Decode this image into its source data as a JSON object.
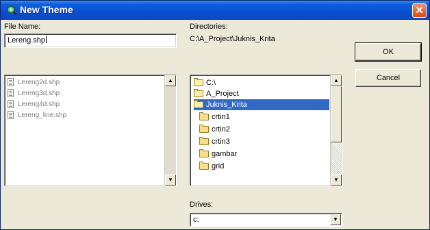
{
  "window": {
    "title": "New Theme",
    "icon": "magnifier-globe-icon",
    "close_icon": "close-icon"
  },
  "file_name": {
    "label": "File Name:",
    "value": "Lereng.shp",
    "files": [
      "Lereng2d.shp",
      "Lereng3d.shp",
      "Lereng4d.shp",
      "Lereng_line.shp"
    ]
  },
  "directories": {
    "label": "Directories:",
    "current_path": "C:\\A_Project\\Juknis_Krita",
    "items": [
      {
        "name": "C:\\",
        "icon": "open-folder-icon",
        "selected": false
      },
      {
        "name": "A_Project",
        "icon": "open-folder-icon",
        "selected": false
      },
      {
        "name": "Juknis_Krita",
        "icon": "open-folder-icon",
        "selected": true
      },
      {
        "name": "crtin1",
        "icon": "folder-icon",
        "selected": false
      },
      {
        "name": "crtin2",
        "icon": "folder-icon",
        "selected": false
      },
      {
        "name": "crtin3",
        "icon": "folder-icon",
        "selected": false
      },
      {
        "name": "gambar",
        "icon": "folder-icon",
        "selected": false
      },
      {
        "name": "grid",
        "icon": "folder-icon",
        "selected": false
      }
    ]
  },
  "drives": {
    "label": "Drives:",
    "value": "c:"
  },
  "buttons": {
    "ok": "OK",
    "cancel": "Cancel"
  },
  "colors": {
    "title_bar": "#0a4fd0",
    "selection": "#316ac5",
    "dialog_bg": "#ece9d8",
    "close_button": "#d84818"
  }
}
